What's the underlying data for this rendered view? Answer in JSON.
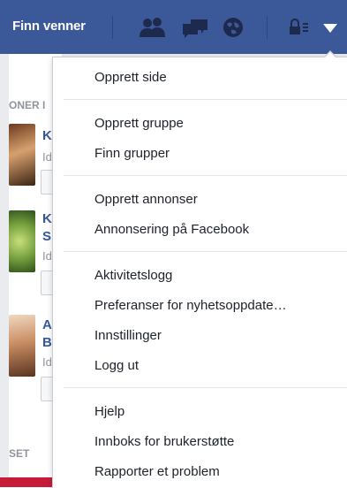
{
  "topbar": {
    "title": "Finn venner"
  },
  "icons": [
    "friends-icon",
    "messages-icon",
    "globe-icon",
    "lock-icon",
    "dropdown-arrow-icon"
  ],
  "background": {
    "section_label_1": "ONER I",
    "section_label_2": "SET",
    "people": [
      {
        "name": "K",
        "sub": "Id"
      },
      {
        "name": "K\nS",
        "sub": "Id"
      },
      {
        "name": "A\nB",
        "sub": "Id"
      }
    ]
  },
  "menu": {
    "group1": [
      "Opprett side"
    ],
    "group2": [
      "Opprett gruppe",
      "Finn grupper"
    ],
    "group3": [
      "Opprett annonser",
      "Annonsering på Facebook"
    ],
    "group4": [
      "Aktivitetslogg",
      "Preferanser for nyhetsoppdate…",
      "Innstillinger",
      "Logg ut"
    ],
    "group5": [
      "Hjelp",
      "Innboks for brukerstøtte",
      "Rapporter et problem"
    ]
  },
  "colors": {
    "brand": "#3b5998",
    "link": "#365899",
    "text": "#1d2129"
  }
}
